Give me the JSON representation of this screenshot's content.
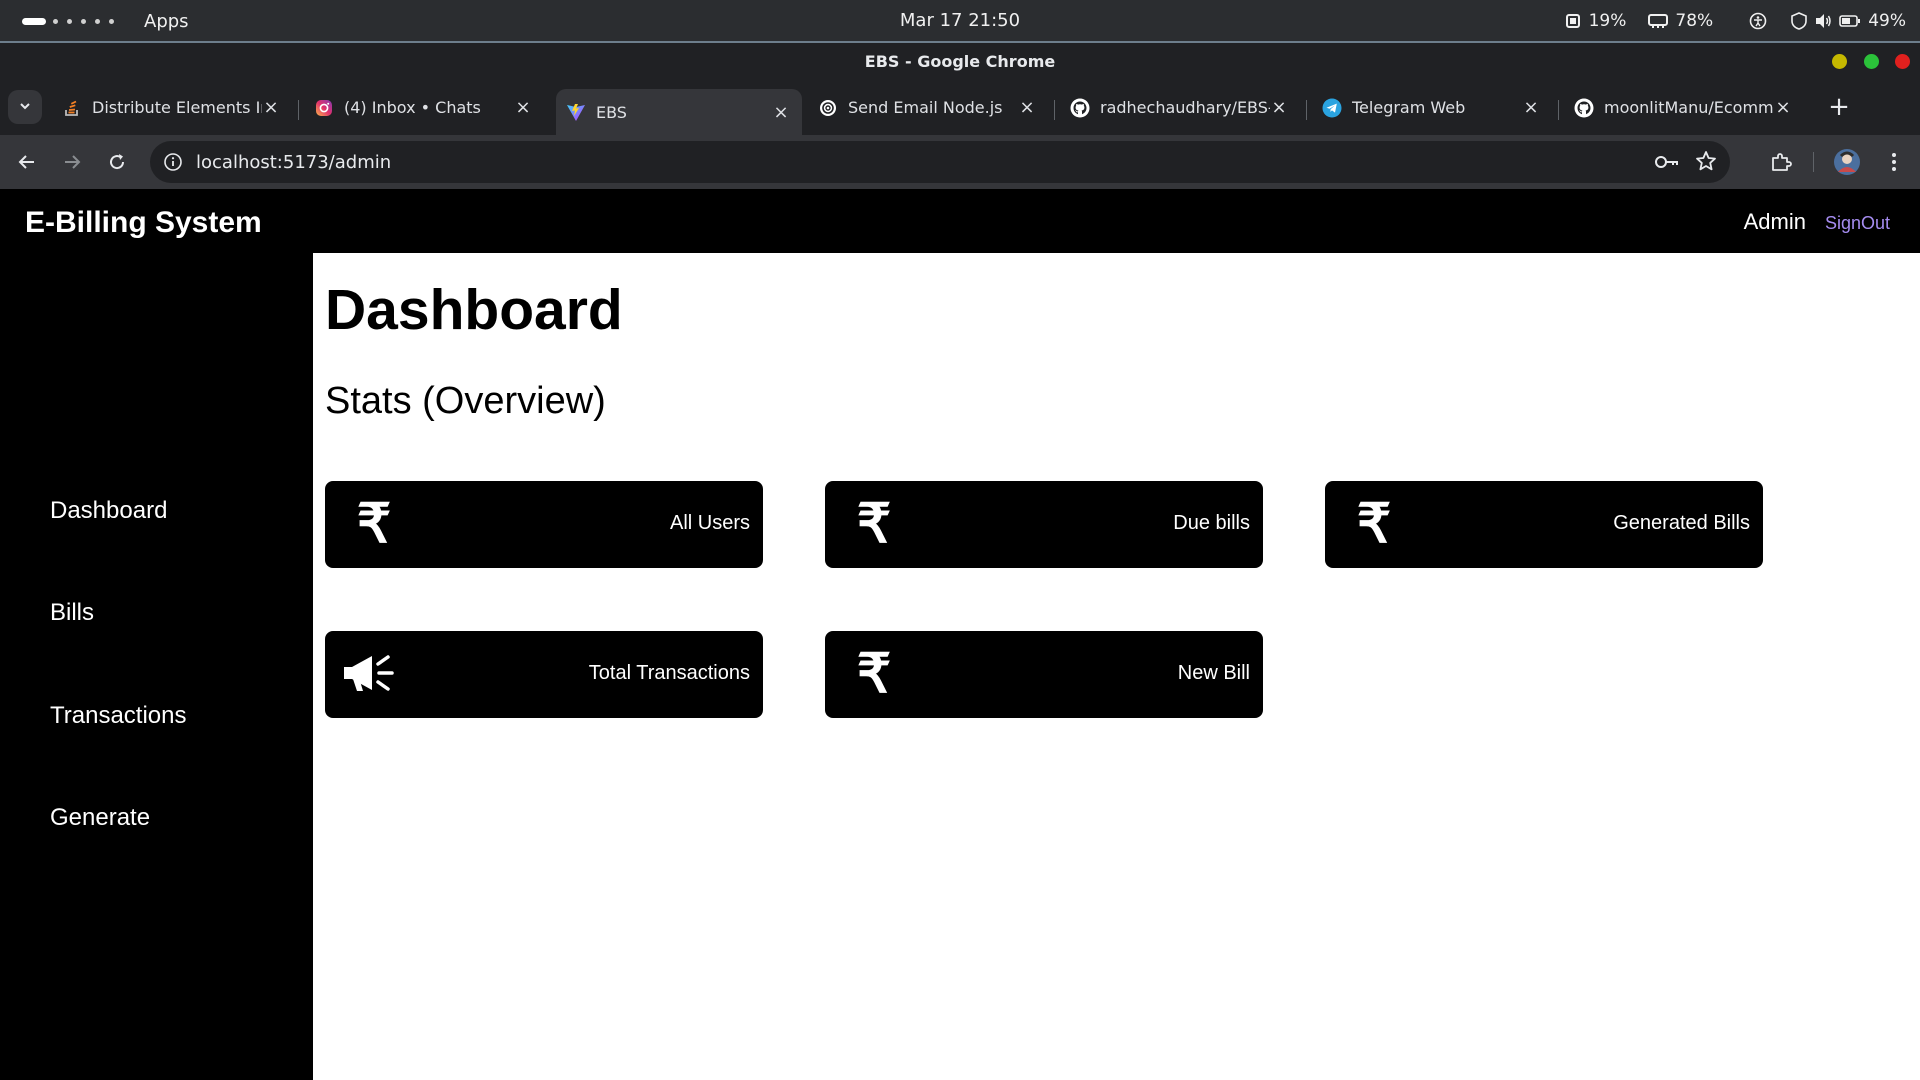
{
  "os": {
    "apps_label": "Apps",
    "datetime": "Mar 17  21:50",
    "cpu": "19%",
    "memory": "78%",
    "battery": "49%"
  },
  "window": {
    "title": "EBS - Google Chrome"
  },
  "tabs": [
    {
      "label": "Distribute Elements In",
      "icon": "stackoverflow-icon"
    },
    {
      "label": "(4) Inbox • Chats",
      "icon": "instagram-icon"
    },
    {
      "label": "EBS",
      "icon": "vite-icon",
      "active": true
    },
    {
      "label": "Send Email Node.js",
      "icon": "openai-icon"
    },
    {
      "label": "radhechaudhary/EBS-",
      "icon": "github-icon"
    },
    {
      "label": "Telegram Web",
      "icon": "telegram-icon"
    },
    {
      "label": "moonlitManu/Ecomm",
      "icon": "github-icon"
    }
  ],
  "address_bar": {
    "url": "localhost:5173/admin"
  },
  "app": {
    "brand": "E-Billing System",
    "user_label": "Admin",
    "signout_label": "SignOut",
    "sidebar": [
      {
        "label": "Dashboard"
      },
      {
        "label": "Bills"
      },
      {
        "label": "Transactions"
      },
      {
        "label": "Generate"
      }
    ],
    "page_title": "Dashboard",
    "section_title": "Stats (Overview)",
    "cards": [
      {
        "label": "All Users",
        "icon": "rupee-icon",
        "glyph": "₹"
      },
      {
        "label": "Due bills",
        "icon": "rupee-icon",
        "glyph": "₹"
      },
      {
        "label": "Generated Bills",
        "icon": "rupee-icon",
        "glyph": "₹"
      },
      {
        "label": "Total Transactions",
        "icon": "megaphone-icon"
      },
      {
        "label": "New Bill",
        "icon": "rupee-icon",
        "glyph": "₹"
      }
    ]
  },
  "colors": {
    "signout": "#a58cf0",
    "app_bg": "#000000",
    "main_bg": "#ffffff",
    "chrome_dark": "#202124",
    "chrome_toolbar": "#35363a"
  }
}
